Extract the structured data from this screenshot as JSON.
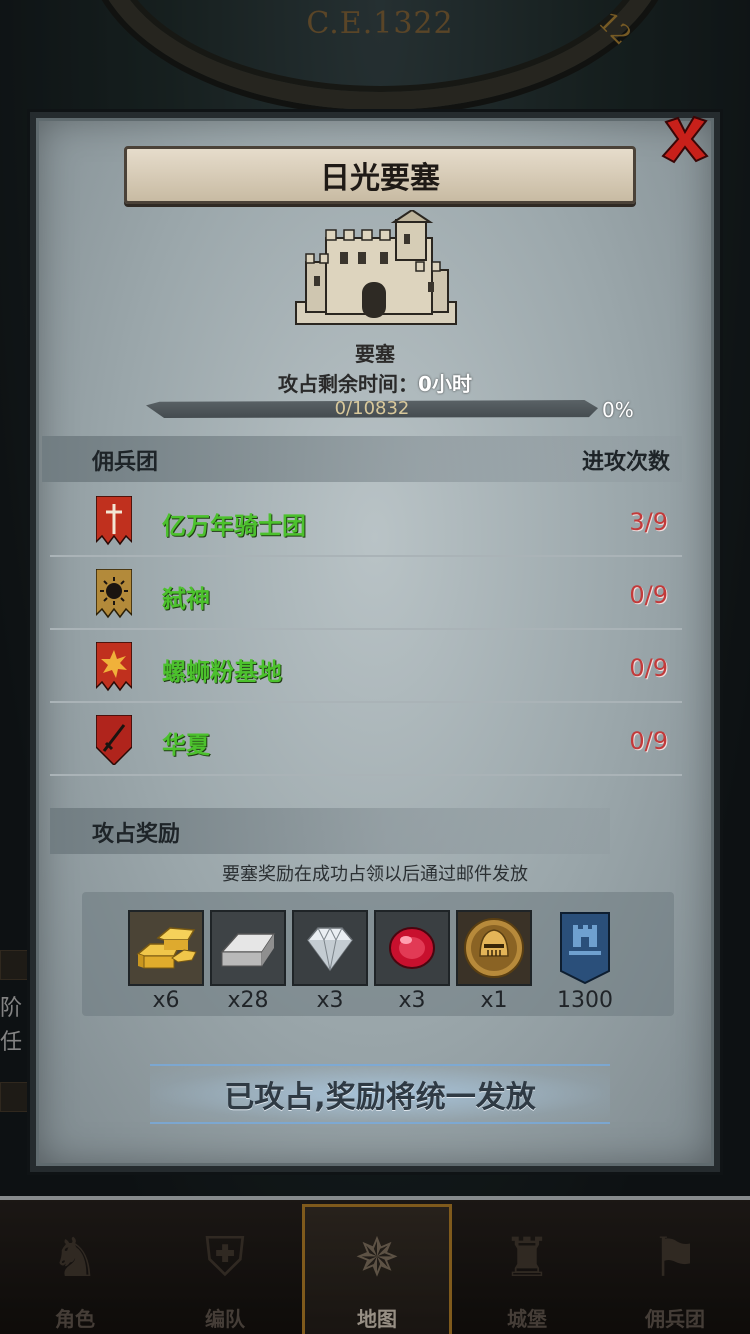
{
  "map": {
    "era_label": "C.E.1322",
    "dial_number": "12",
    "side_texts": [
      "阶",
      "任"
    ]
  },
  "dialog": {
    "title": "日光要塞",
    "fortress_type": "要塞",
    "time_label": "攻占剩余时间：",
    "time_value": "0小时",
    "progress_text": "0/10832",
    "progress_fraction": 0,
    "progress_pct": "0%",
    "mercenary_header": "佣兵团",
    "attack_count_header": "进攻次数",
    "mercenaries": [
      {
        "name": "亿万年骑士团",
        "count": "3/9",
        "banner_color": "#c0301e",
        "emblem": "sword"
      },
      {
        "name": "弑神",
        "count": "0/9",
        "banner_color": "#b38a3a",
        "emblem": "sun"
      },
      {
        "name": "螺蛳粉基地",
        "count": "0/9",
        "banner_color": "#c0301e",
        "emblem": "burst"
      },
      {
        "name": "华夏",
        "count": "0/9",
        "banner_color": "#b0241c",
        "emblem": "blade"
      }
    ],
    "reward_header": "攻占奖励",
    "reward_note": "要塞奖励在成功占领以后通过邮件发放",
    "rewards": [
      {
        "icon": "gold-bar-icon",
        "qty": "x6"
      },
      {
        "icon": "iron-ingot-icon",
        "qty": "x28"
      },
      {
        "icon": "diamond-icon",
        "qty": "x3"
      },
      {
        "icon": "ruby-icon",
        "qty": "x3"
      },
      {
        "icon": "knight-helmet-coin-icon",
        "qty": "x1"
      },
      {
        "icon": "castle-banner-icon",
        "qty": "1300"
      }
    ],
    "claim_text": "已攻占,奖励将统一发放"
  },
  "nav": {
    "items": [
      {
        "label": "角色",
        "icon": "character-icon"
      },
      {
        "label": "编队",
        "icon": "formation-icon"
      },
      {
        "label": "地图",
        "icon": "compass-map-icon",
        "active": true
      },
      {
        "label": "城堡",
        "icon": "castle-icon"
      },
      {
        "label": "佣兵团",
        "icon": "mercenary-icon"
      }
    ]
  },
  "colors": {
    "merc_name": "#4cc12d",
    "count_text": "#c23a3a",
    "nav_active_border": "#c48b2c"
  }
}
